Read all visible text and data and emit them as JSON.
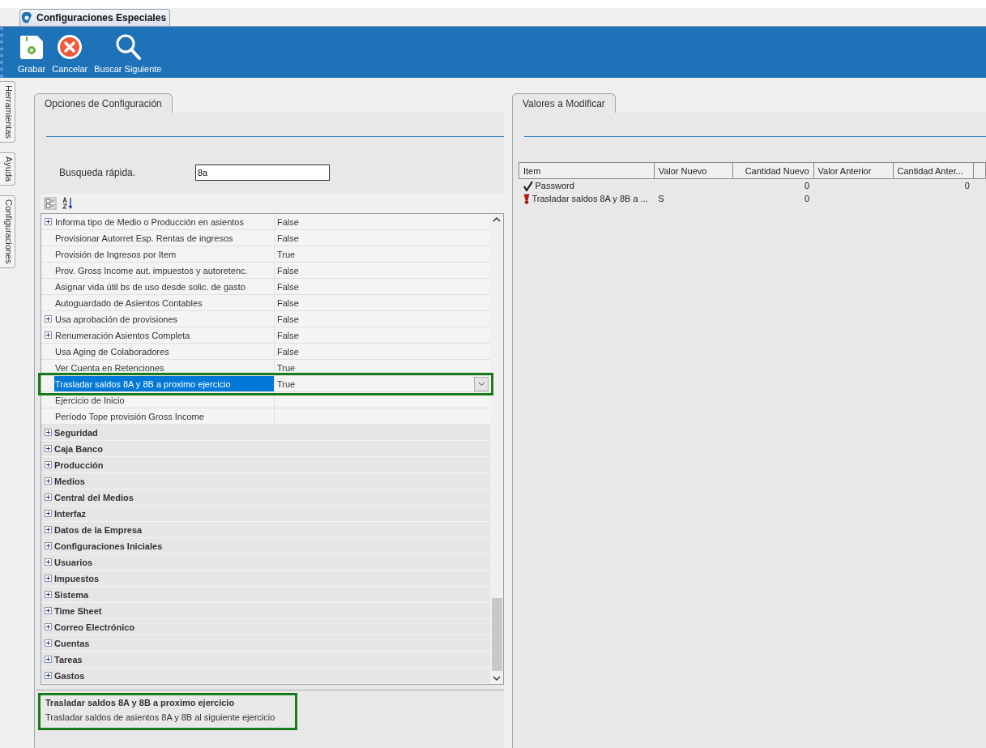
{
  "document_tab": {
    "title": "Configuraciones Especiales"
  },
  "toolbar": [
    {
      "kind": "save",
      "label": "Grabar"
    },
    {
      "kind": "cancel",
      "label": "Cancelar"
    },
    {
      "kind": "search",
      "label": "Buscar Siguiente"
    }
  ],
  "side_tabs": [
    "Herramientas",
    "Ayuda",
    "Configuraciones"
  ],
  "left_panel": {
    "tab": "Opciones de Configuración",
    "search_label": "Busqueda rápida.",
    "search_value": "8a",
    "grid": [
      {
        "kind": "property",
        "expandable": true,
        "name": "Informa tipo de Medio o Producción en asientos",
        "value": "False",
        "selected": false
      },
      {
        "kind": "property",
        "expandable": false,
        "name": "Provisionar Autorret Esp. Rentas de ingresos",
        "value": "False",
        "selected": false
      },
      {
        "kind": "property",
        "expandable": false,
        "name": "Provisión de Ingresos por Item",
        "value": "True",
        "selected": false
      },
      {
        "kind": "property",
        "expandable": false,
        "name": "Prov. Gross Income aut. impuestos y autoretenc.",
        "value": "False",
        "selected": false
      },
      {
        "kind": "property",
        "expandable": false,
        "name": "Asignar vida útil bs de uso desde solic. de gasto",
        "value": "False",
        "selected": false
      },
      {
        "kind": "property",
        "expandable": false,
        "name": "Autoguardado de Asientos Contables",
        "value": "False",
        "selected": false
      },
      {
        "kind": "property",
        "expandable": true,
        "name": "Usa aprobación de provisiones",
        "value": "False",
        "selected": false
      },
      {
        "kind": "property",
        "expandable": true,
        "name": "Renumeración Asientos Completa",
        "value": "False",
        "selected": false
      },
      {
        "kind": "property",
        "expandable": false,
        "name": "Usa Aging de Colaboradores",
        "value": "False",
        "selected": false
      },
      {
        "kind": "property",
        "expandable": false,
        "name": "Ver Cuenta en Retenciones",
        "value": "True",
        "selected": false
      },
      {
        "kind": "property",
        "expandable": false,
        "name": "Trasladar saldos 8A y 8B a proximo ejercicio",
        "value": "True",
        "selected": true
      },
      {
        "kind": "property",
        "expandable": false,
        "name": "Ejercicio de Inicio",
        "selected": false
      },
      {
        "kind": "property",
        "expandable": false,
        "name": "Período Tope provisión Gross Income",
        "selected": false
      },
      {
        "kind": "category",
        "name": "Seguridad"
      },
      {
        "kind": "category",
        "name": "Caja Banco"
      },
      {
        "kind": "category",
        "name": "Producción"
      },
      {
        "kind": "category",
        "name": "Medios"
      },
      {
        "kind": "category",
        "name": "Central del Medios"
      },
      {
        "kind": "category",
        "name": "Interfaz"
      },
      {
        "kind": "category",
        "name": "Datos de la Empresa"
      },
      {
        "kind": "category",
        "name": "Configuraciones Iniciales"
      },
      {
        "kind": "category",
        "name": "Usuarios"
      },
      {
        "kind": "category",
        "name": "Impuestos"
      },
      {
        "kind": "category",
        "name": "Sistema"
      },
      {
        "kind": "category",
        "name": "Time Sheet"
      },
      {
        "kind": "category",
        "name": "Correo Electrónico"
      },
      {
        "kind": "category",
        "name": "Cuentas"
      },
      {
        "kind": "category",
        "name": "Tareas"
      },
      {
        "kind": "category",
        "name": "Gastos"
      }
    ],
    "description": {
      "title": "Trasladar saldos 8A y 8B a proximo ejercicio",
      "text": "Trasladar saldos de asientos 8A y 8B al siguiente ejercicio",
      "highlighted": true
    }
  },
  "right_panel": {
    "tab": "Valores a Modificar",
    "table": {
      "columns": [
        "Item",
        "Valor Nuevo",
        "Cantidad Nuevo",
        "Valor Anterior",
        "Cantidad Anter..."
      ],
      "rows": [
        {
          "kind": "check",
          "cells": [
            "Password",
            "",
            "0",
            "",
            "0"
          ]
        },
        {
          "kind": "alert",
          "cells": [
            "Trasladar saldos 8A y 8B a ...",
            "S",
            "0",
            "",
            ""
          ]
        }
      ]
    }
  }
}
